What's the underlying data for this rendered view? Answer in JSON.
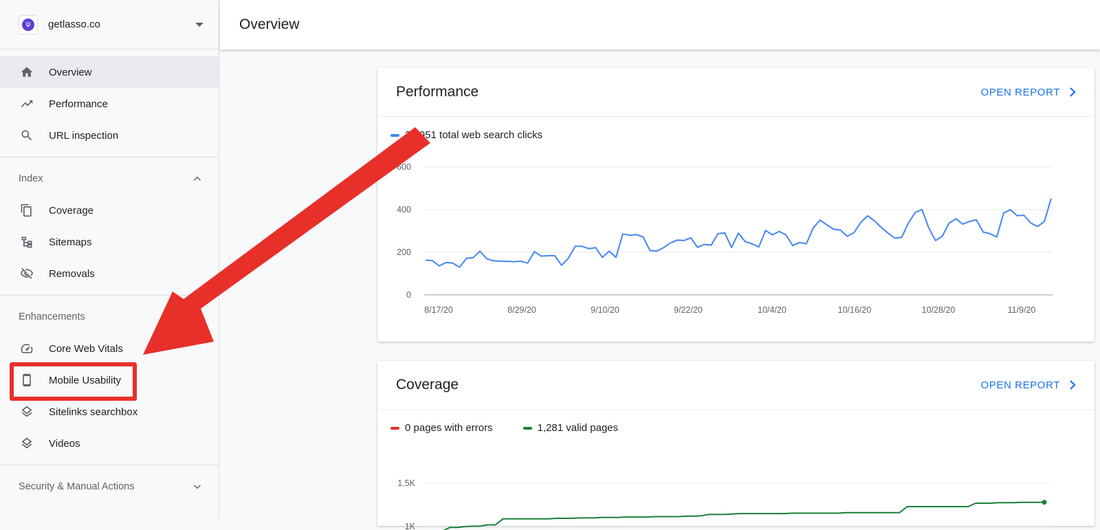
{
  "property": {
    "name": "getlasso.co",
    "logo_icon": "lasso-logo-icon"
  },
  "header": {
    "title": "Overview"
  },
  "sidebar": {
    "top_items": [
      {
        "label": "Overview",
        "icon": "home-icon",
        "active": true
      },
      {
        "label": "Performance",
        "icon": "trending-up-icon"
      },
      {
        "label": "URL inspection",
        "icon": "search-icon"
      }
    ],
    "index": {
      "title": "Index",
      "items": [
        {
          "label": "Coverage",
          "icon": "coverage-icon"
        },
        {
          "label": "Sitemaps",
          "icon": "sitemaps-icon"
        },
        {
          "label": "Removals",
          "icon": "removals-icon"
        }
      ]
    },
    "enhancements": {
      "title": "Enhancements",
      "items": [
        {
          "label": "Core Web Vitals",
          "icon": "gauge-icon"
        },
        {
          "label": "Mobile Usability",
          "icon": "mobile-icon"
        },
        {
          "label": "Sitelinks searchbox",
          "icon": "layers-icon"
        },
        {
          "label": "Videos",
          "icon": "layers-icon"
        }
      ]
    },
    "security": {
      "title": "Security & Manual Actions"
    }
  },
  "cards": {
    "performance": {
      "title": "Performance",
      "open_report": "OPEN REPORT",
      "legend": "22,951 total web search clicks"
    },
    "coverage": {
      "title": "Coverage",
      "open_report": "OPEN REPORT",
      "legend_errors": "0 pages with errors",
      "legend_valid": "1,281 valid pages"
    }
  },
  "colors": {
    "accent": "#1a73e8",
    "clicks_line": "#4285f4",
    "valid_line": "#188038",
    "error_line": "#d93025",
    "annotation": "#e8302a"
  },
  "chart_data": [
    {
      "type": "line",
      "title": "",
      "series": [
        {
          "name": "22,951 total web search clicks",
          "values": [
            163,
            161,
            136,
            152,
            149,
            130,
            171,
            175,
            205,
            169,
            160,
            158,
            157,
            156,
            158,
            149,
            203,
            182,
            184,
            184,
            139,
            172,
            228,
            228,
            217,
            222,
            176,
            205,
            176,
            286,
            280,
            283,
            272,
            208,
            205,
            222,
            244,
            257,
            255,
            268,
            223,
            237,
            233,
            287,
            291,
            222,
            290,
            250,
            240,
            225,
            302,
            282,
            298,
            282,
            231,
            246,
            240,
            314,
            351,
            329,
            308,
            304,
            275,
            292,
            340,
            371,
            348,
            317,
            290,
            266,
            270,
            337,
            387,
            400,
            314,
            255,
            276,
            337,
            357,
            332,
            345,
            352,
            295,
            287,
            272,
            384,
            400,
            372,
            374,
            337,
            321,
            345,
            453
          ]
        }
      ],
      "x_tick_labels": [
        "8/17/20",
        "8/29/20",
        "9/10/20",
        "9/22/20",
        "10/4/20",
        "10/16/20",
        "10/28/20",
        "11/9/20"
      ],
      "y_ticks": [
        0,
        200,
        400,
        600
      ],
      "ylim": [
        0,
        600
      ]
    },
    {
      "type": "line",
      "title": "",
      "series": [
        {
          "name": "1,281 valid pages",
          "values": [
            945,
            990,
            990,
            1000,
            1005,
            1005,
            1020,
            1020,
            1090,
            1090,
            1090,
            1090,
            1090,
            1090,
            1090,
            1095,
            1095,
            1095,
            1100,
            1100,
            1100,
            1105,
            1105,
            1105,
            1110,
            1110,
            1110,
            1110,
            1115,
            1115,
            1115,
            1115,
            1120,
            1120,
            1125,
            1140,
            1140,
            1140,
            1145,
            1150,
            1150,
            1150,
            1150,
            1150,
            1150,
            1150,
            1155,
            1155,
            1155,
            1155,
            1155,
            1155,
            1155,
            1160,
            1160,
            1160,
            1160,
            1160,
            1160,
            1160,
            1160,
            1230,
            1230,
            1230,
            1230,
            1230,
            1230,
            1230,
            1230,
            1230,
            1270,
            1270,
            1270,
            1275,
            1275,
            1275,
            1280,
            1280,
            1280,
            1281
          ]
        },
        {
          "name": "0 pages with errors",
          "values": []
        }
      ],
      "y_tick_labels": [
        "1K",
        "1.5K"
      ],
      "y_ticks": [
        1000,
        1500
      ]
    }
  ]
}
